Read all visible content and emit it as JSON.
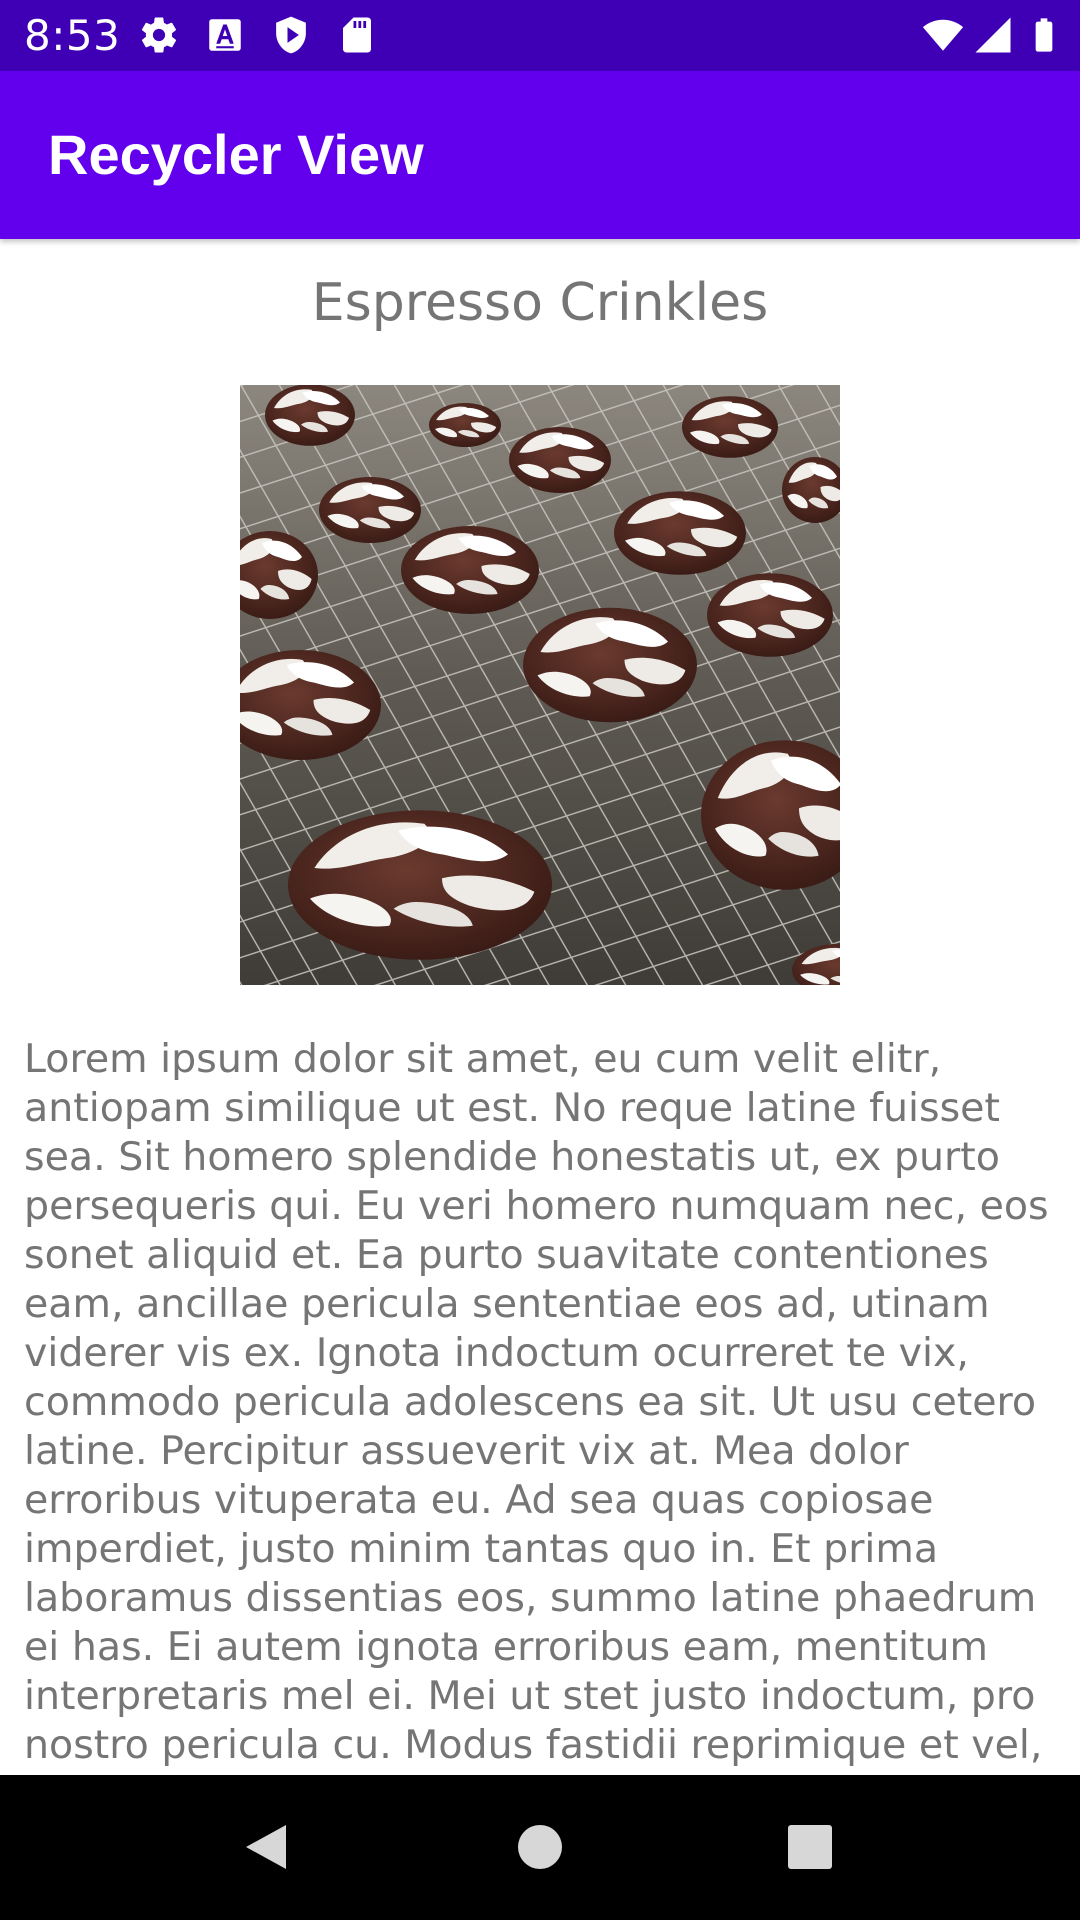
{
  "status_bar": {
    "time": "8:53",
    "icons": [
      "settings-gear-icon",
      "text-a-icon",
      "play-protect-icon",
      "sd-card-icon",
      "wifi-icon",
      "cell-signal-icon",
      "battery-icon"
    ],
    "color": "#3f00b5"
  },
  "app_bar": {
    "title": "Recycler View",
    "color": "#6200ee"
  },
  "item": {
    "title": "Espresso Crinkles",
    "image": "crinkle-cookies-photo",
    "description": "Lorem ipsum dolor sit amet, eu cum velit elitr, antiopam similique ut est. No reque latine fuisset sea. Sit homero splendide honestatis ut, ex purto persequeris qui. Eu veri homero numquam nec, eos sonet aliquid et. Ea purto suavitate contentiones eam, ancillae pericula sententiae eos ad, utinam viderer vis ex. Ignota indoctum ocurreret te vix, commodo pericula adolescens ea sit. Ut usu cetero latine. Percipitur assueverit vix at. Mea dolor erroribus vituperata eu. Ad sea quas copiosae imperdiet, justo minim tantas quo in. Et prima laboramus dissentias eos, summo latine phaedrum ei has. Ei autem ignota erroribus eam, mentitum interpretaris mel ei. Mei ut stet justo indoctum, pro nostro pericula cu. Modus fastidii reprimique et vel, amet tation postulant ne quo, at"
  },
  "nav_bar": {
    "buttons": [
      "back-icon",
      "home-icon",
      "recents-icon"
    ]
  }
}
